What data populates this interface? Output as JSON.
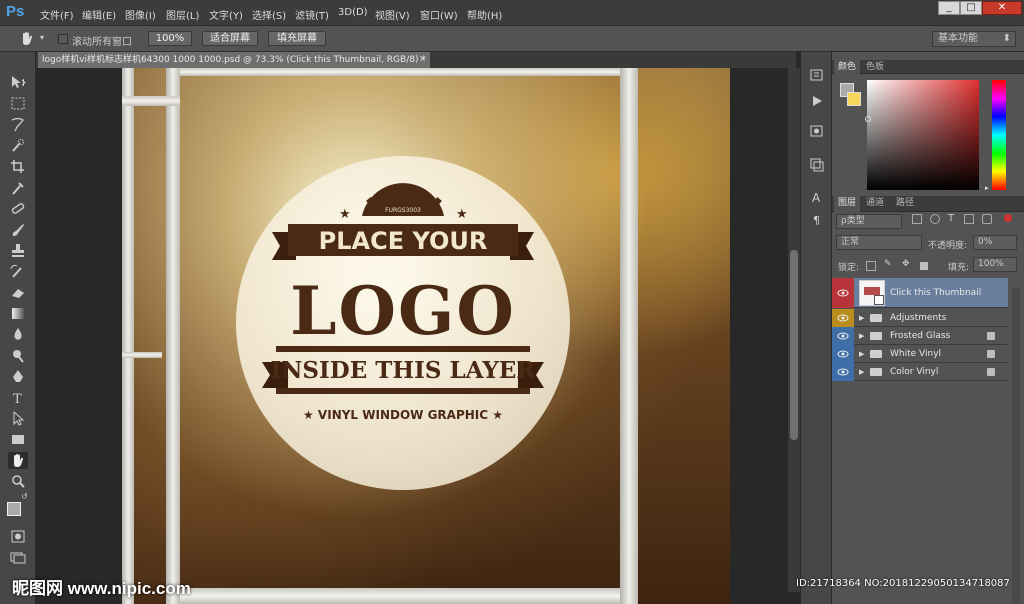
{
  "app": {
    "logo": "Ps",
    "menu": [
      "文件(F)",
      "编辑(E)",
      "图像(I)",
      "图层(L)",
      "文字(Y)",
      "选择(S)",
      "滤镜(T)",
      "3D(D)",
      "视图(V)",
      "窗口(W)",
      "帮助(H)"
    ],
    "window_controls": [
      "_",
      "□",
      "✕"
    ]
  },
  "options_bar": {
    "scroll_all_windows": "滚动所有窗口",
    "zoom_100": "100%",
    "fit_screen": "适合屏幕",
    "fill_screen": "填充屏幕",
    "workspace": "基本功能"
  },
  "document": {
    "tab_title": "logo样机vi样机标志样机64300 1000 1000.psd @ 73.3% (Click this Thumbnail, RGB/8) *",
    "tab_close": "✕",
    "mockup": {
      "ribbon_top": "PLACE YOUR",
      "main": "LOGO",
      "ribbon_bottom": "INSIDE THIS LAYER",
      "sub": "★ VINYL WINDOW GRAPHIC ★",
      "badge": "FURGS3003"
    }
  },
  "color_panel": {
    "tabs": [
      "颜色",
      "色板"
    ],
    "foreground": "#aaaaaa",
    "background": "#f5d75b"
  },
  "layers_panel": {
    "tabs": [
      "图层",
      "通道",
      "路径"
    ],
    "filter": "ρ类型",
    "blend_mode": "正常",
    "opacity_label": "不透明度:",
    "opacity_value": "0%",
    "lock_label": "锁定:",
    "fill_label": "填充:",
    "fill_value": "100%",
    "layers": [
      {
        "name": "Click this Thumbnail",
        "eye_color": "#b8343a",
        "selected": true
      },
      {
        "name": "Adjustments",
        "eye_color": "#b88d1d",
        "selected": false
      },
      {
        "name": "Frosted Glass",
        "eye_color": "#3f6ea8",
        "selected": false
      },
      {
        "name": "White Vinyl",
        "eye_color": "#3f6ea8",
        "selected": false
      },
      {
        "name": "Color Vinyl",
        "eye_color": "#3f6ea8",
        "selected": false
      }
    ]
  },
  "watermark": {
    "left": "昵图网 www.nipic.com",
    "right": "ID:21718364 NO:20181229050134718087"
  }
}
